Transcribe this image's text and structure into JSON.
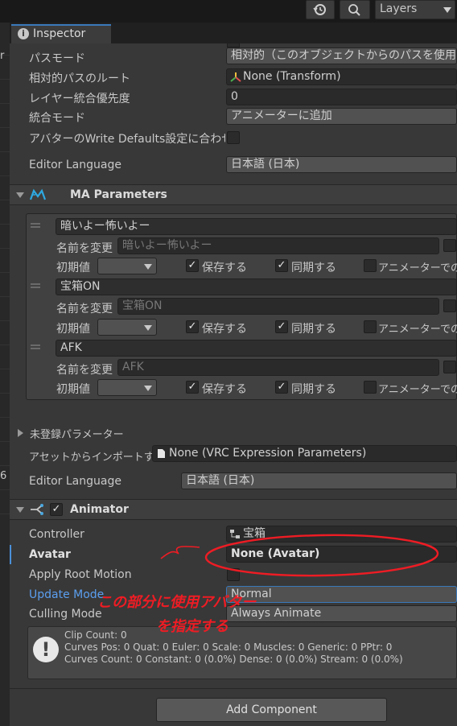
{
  "toolbar": {
    "history_icon": "history-icon",
    "search_icon": "search-icon",
    "layers_label": "Layers"
  },
  "tab": {
    "label": "Inspector",
    "icon": "info-icon"
  },
  "left_strip": {
    "text_1": "r",
    "text_2": "6"
  },
  "merge_props": [
    {
      "label": "パスモード",
      "value": "相対的（このオブジェクトからのパスを使用）"
    },
    {
      "label": "相対的パスのルート",
      "value": "None (Transform)"
    },
    {
      "label": "レイヤー統合優先度",
      "value": "0"
    },
    {
      "label": "統合モード",
      "value": "アニメーターに追加"
    },
    {
      "label": "アバターのWrite Defaults設定に合わせる"
    }
  ],
  "editor_language_1": {
    "label": "Editor Language",
    "value": "日本語 (日本)"
  },
  "ma_parameters": {
    "title": "MA Parameters",
    "rename_label": "名前を変更",
    "initial_label": "初期値",
    "saved_label": "保存する",
    "synced_label": "同期する",
    "animator_only_label": "アニメーターでの初",
    "params": [
      {
        "name": "暗いよー怖いよー",
        "rename_placeholder": "暗いよー怖いよー",
        "saved": true,
        "synced": true,
        "animator_only": false
      },
      {
        "name": "宝箱ON",
        "rename_placeholder": "宝箱ON",
        "saved": true,
        "synced": true,
        "animator_only": false
      },
      {
        "name": "AFK",
        "rename_placeholder": "AFK",
        "saved": true,
        "synced": true,
        "animator_only": false
      }
    ],
    "unregistered_label": "未登録パラメーター",
    "import_label": "アセットからインポートする",
    "import_value": "None (VRC Expression Parameters)",
    "editor_language_label": "Editor Language",
    "editor_language_value": "日本語 (日本)"
  },
  "animator": {
    "title": "Animator",
    "enabled": true,
    "controller_label": "Controller",
    "controller_value": "宝箱",
    "avatar_label": "Avatar",
    "avatar_value": "None (Avatar)",
    "apply_root_motion_label": "Apply Root Motion",
    "update_mode_label": "Update Mode",
    "update_mode_value": "Normal",
    "culling_mode_label": "Culling Mode",
    "culling_mode_value": "Always Animate",
    "info_lines": [
      "Clip Count: 0",
      "Curves Pos: 0 Quat: 0 Euler: 0 Scale: 0 Muscles: 0 Generic: 0 PPtr: 0",
      "Curves Count: 0 Constant: 0 (0.0%) Dense: 0 (0.0%) Stream: 0 (0.0%)"
    ]
  },
  "add_component_label": "Add Component",
  "annotation": {
    "line1": "この部分に使用アバター",
    "line2": "を指定する",
    "color": "#ee1c24"
  }
}
